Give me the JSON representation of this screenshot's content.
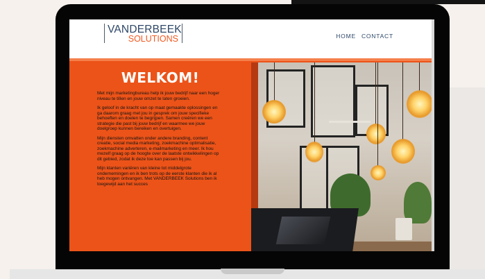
{
  "site": {
    "logo": {
      "line1": "VANDERBEEK",
      "line2": "SOLUTIONS"
    },
    "nav": [
      {
        "label": "HOME"
      },
      {
        "label": "CONTACT"
      }
    ]
  },
  "hero": {
    "title": "WELKOM!",
    "paragraphs": [
      "Met mijn marketingbureau help ik jouw bedrijf naar een hoger niveau te tillen en jouw omzet te laten groeien.",
      "Ik geloof in de kracht van op maat gemaakte oplossingen en ga daarom graag met jou in gesprek om jouw specifieke behoeften en doelen te begrijpen. Samen creëren we een strategie die past bij jouw bedrijf en waarmee we jouw doelgroep kunnen bereiken en overtuigen.",
      "Mijn diensten omvatten onder andere branding, content creatie, social media marketing, zoekmachine optimalisatie, zoekmachine adverteren, e-mailmarketing en meer. Ik hou mezelf graag op de hoogte over de laatste ontwikkelingen op dit gebied, zodat ik deze toe kan passen bij jou.",
      "Mijn klanten variëren van kleine tot middelgrote ondernemingen en ik ben trots op de eerste klanten die ik al heb mogen ontvangen. Met VANDERBEEK Solutions ben ik toegewijd aan het succes"
    ]
  },
  "colors": {
    "accent": "#ec5318",
    "brand_navy": "#2d4768",
    "laptop_frame": "#050505"
  }
}
